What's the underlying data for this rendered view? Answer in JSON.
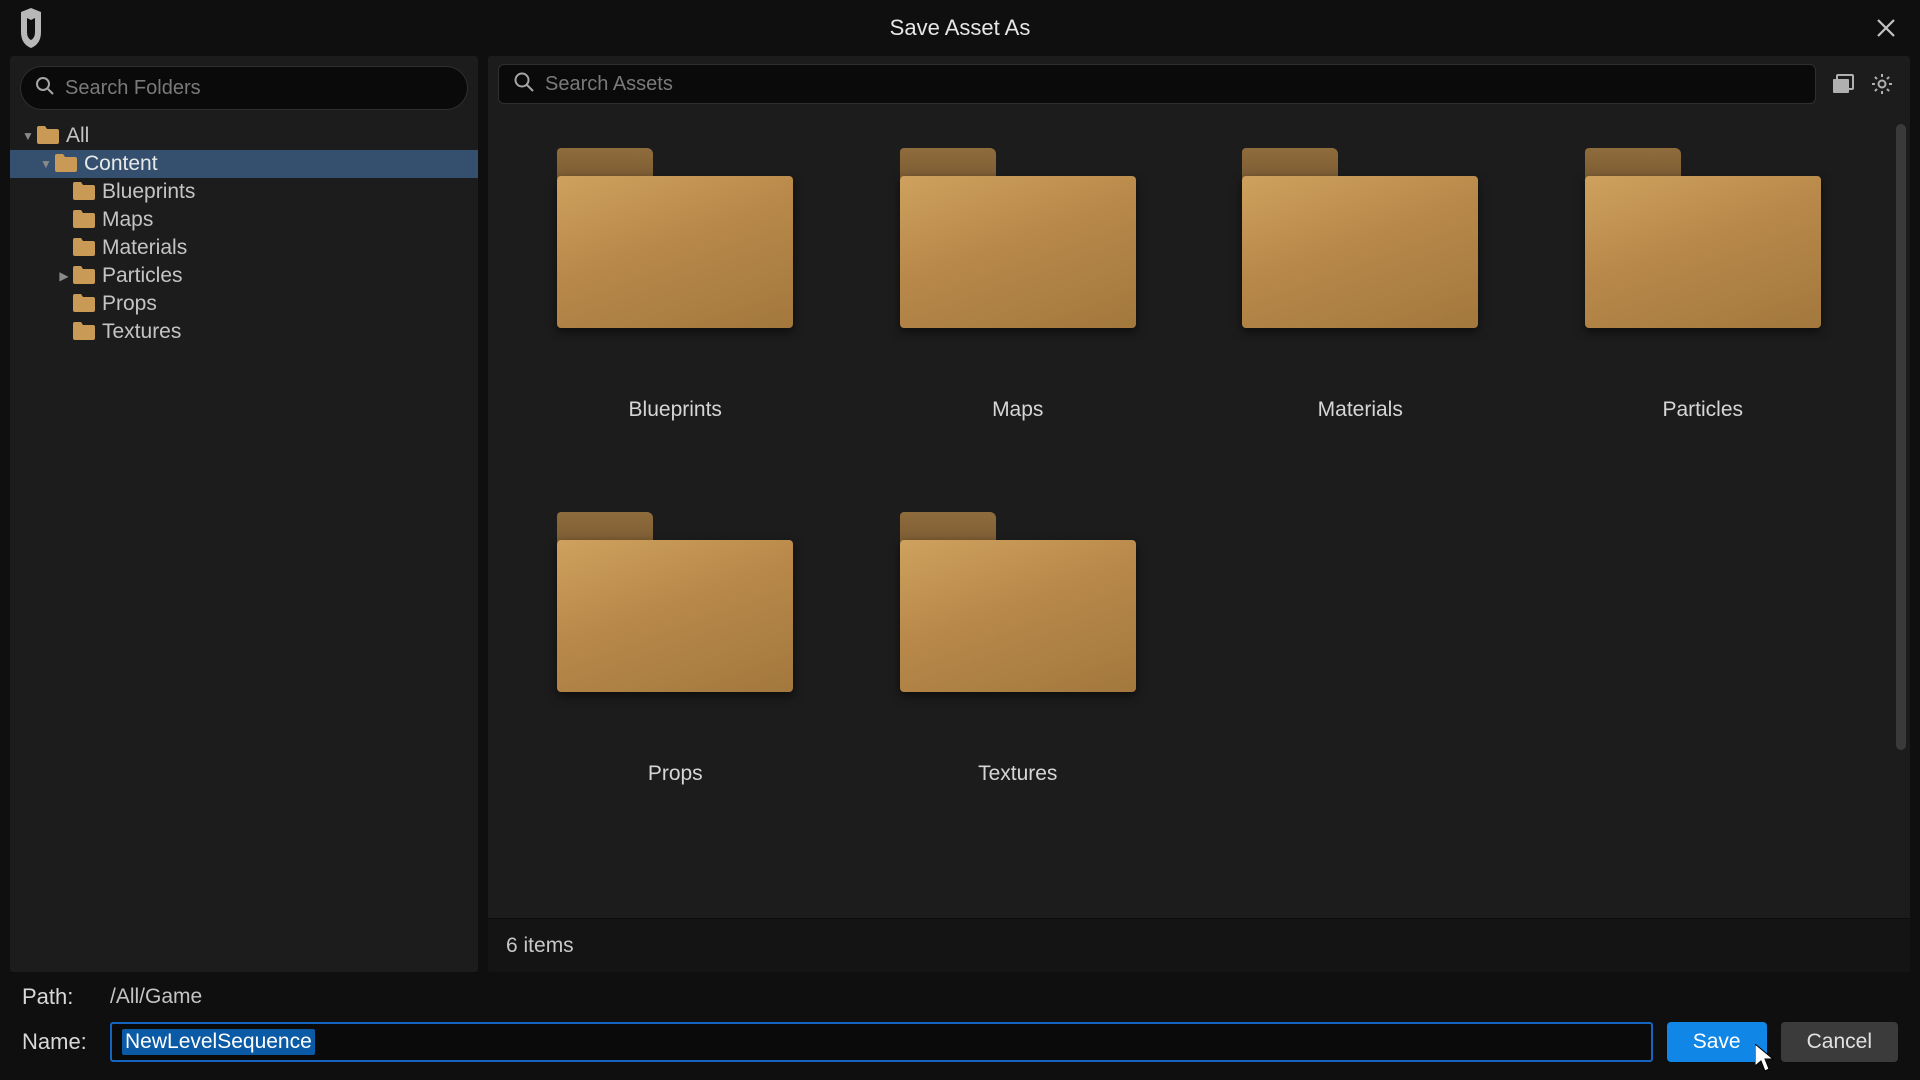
{
  "dialog": {
    "title": "Save Asset As"
  },
  "sidebar": {
    "search_placeholder": "Search Folders",
    "tree": {
      "root": "All",
      "node1": "Content",
      "children": [
        "Blueprints",
        "Maps",
        "Materials",
        "Particles",
        "Props",
        "Textures"
      ]
    }
  },
  "assets": {
    "search_placeholder": "Search Assets",
    "folders": [
      "Blueprints",
      "Maps",
      "Materials",
      "Particles",
      "Props",
      "Textures"
    ],
    "count_text": "6 items"
  },
  "footer": {
    "path_label": "Path:",
    "path_value": "/All/Game",
    "name_label": "Name:",
    "name_value": "NewLevelSequence",
    "save_label": "Save",
    "cancel_label": "Cancel"
  }
}
